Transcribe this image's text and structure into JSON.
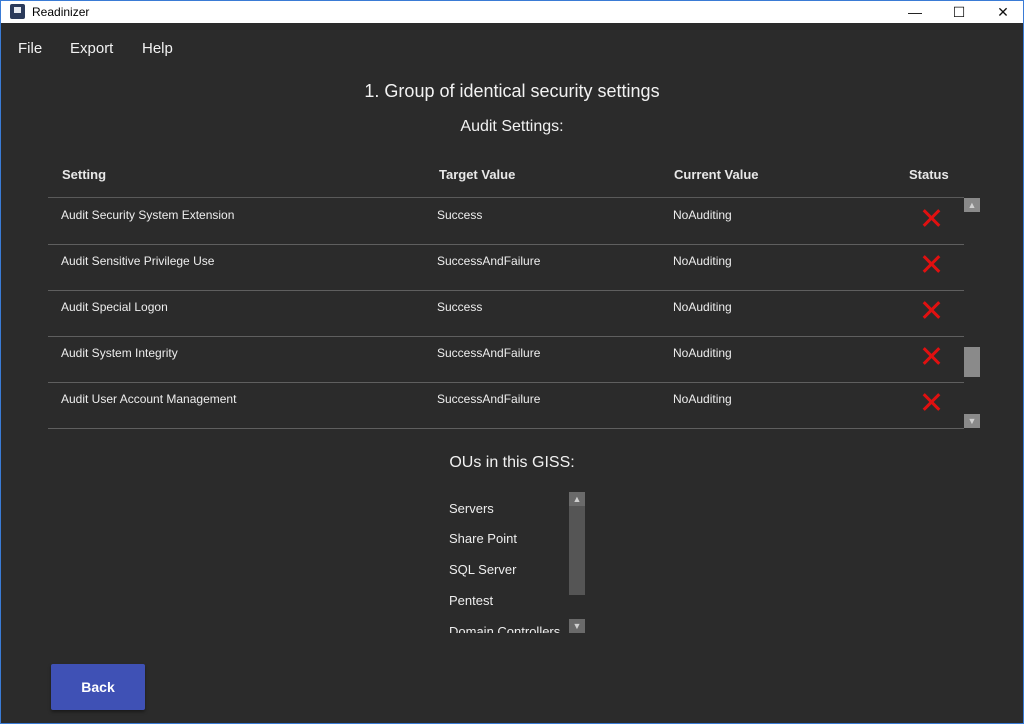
{
  "window": {
    "title": "Readinizer",
    "minimize": "—",
    "maximize": "☐",
    "close": "✕"
  },
  "menu": {
    "file": "File",
    "export": "Export",
    "help": "Help"
  },
  "page": {
    "title": "1. Group of identical security settings",
    "audit_heading": "Audit Settings:",
    "ou_heading": "OUs in this GISS:"
  },
  "table": {
    "columns": [
      "Setting",
      "Target Value",
      "Current Value",
      "Status"
    ],
    "rows": [
      {
        "setting": "Audit Security System Extension",
        "target": "Success",
        "current": "NoAuditing",
        "status": "failed"
      },
      {
        "setting": "Audit Sensitive Privilege Use",
        "target": "SuccessAndFailure",
        "current": "NoAuditing",
        "status": "failed"
      },
      {
        "setting": "Audit Special Logon",
        "target": "Success",
        "current": "NoAuditing",
        "status": "failed"
      },
      {
        "setting": "Audit System Integrity",
        "target": "SuccessAndFailure",
        "current": "NoAuditing",
        "status": "failed"
      },
      {
        "setting": "Audit User Account Management",
        "target": "SuccessAndFailure",
        "current": "NoAuditing",
        "status": "failed"
      }
    ]
  },
  "ous": [
    "Servers",
    "Share Point",
    "SQL Server",
    "Pentest",
    "Domain Controllers"
  ],
  "buttons": {
    "back": "Back"
  },
  "colors": {
    "accent": "#3f51b5",
    "status_fail": "#e01010",
    "background": "#2b2b2b"
  },
  "icons": {
    "status": "close-icon"
  }
}
